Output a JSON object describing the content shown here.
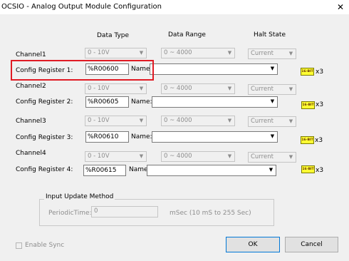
{
  "window": {
    "title": "OCSIO - Analog Output Module Configuration",
    "close_glyph": "✕"
  },
  "headers": {
    "data_type": "Data Type",
    "data_range": "Data Range",
    "halt_state": "Halt State"
  },
  "channels": [
    {
      "channel_label": "Channel1",
      "data_type": "0 - 10V",
      "data_range": "0 ~ 4000",
      "halt_state": "Current",
      "config_label": "Config Register 1:",
      "register": "%R00600",
      "name_label": "Name:",
      "name_value": "",
      "badge": "16-BIT",
      "multiplier": "x3"
    },
    {
      "channel_label": "Channel2",
      "data_type": "0 - 10V",
      "data_range": "0 ~ 4000",
      "halt_state": "Current",
      "config_label": "Config Register 2:",
      "register": "%R00605",
      "name_label": "Name:",
      "name_value": "",
      "badge": "16-BIT",
      "multiplier": "x3"
    },
    {
      "channel_label": "Channel3",
      "data_type": "0 - 10V",
      "data_range": "0 ~ 4000",
      "halt_state": "Current",
      "config_label": "Config Register 3:",
      "register": "%R00610",
      "name_label": "Name:",
      "name_value": "",
      "badge": "16-BIT",
      "multiplier": "x3"
    },
    {
      "channel_label": "Channel4",
      "data_type": "0 - 10V",
      "data_range": "0 ~ 4000",
      "halt_state": "Current",
      "config_label": "Config Register 4:",
      "register": "%R00615",
      "name_label": "Name:",
      "name_value": "",
      "badge": "16-BIT",
      "multiplier": "x3"
    }
  ],
  "input_update": {
    "group_label": "Input Update Method",
    "periodic_label": "PeriodicTime:",
    "periodic_value": "0",
    "units_hint": "mSec  (10 mS to 255 Sec)"
  },
  "footer": {
    "enable_sync_label": "Enable Sync",
    "enable_sync_checked": false,
    "ok_label": "OK",
    "cancel_label": "Cancel"
  },
  "icons": {
    "dropdown": "chevron-down-icon",
    "close": "close-icon"
  }
}
